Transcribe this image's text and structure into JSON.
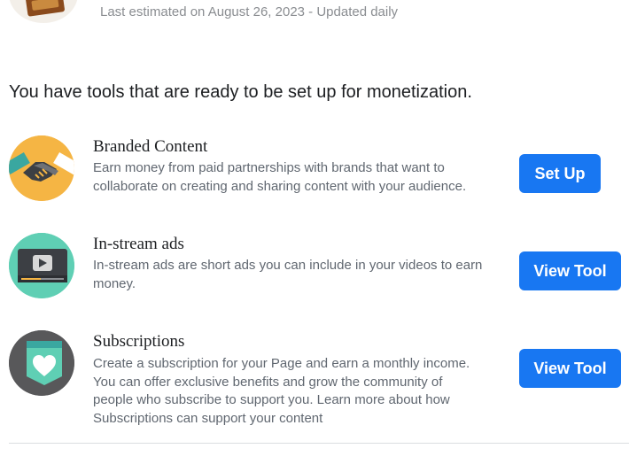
{
  "header": {
    "estimate_text": "Last estimated on August 26, 2023 - Updated daily"
  },
  "headline": "You have tools that are ready to be set up for monetization.",
  "tools": [
    {
      "title": "Branded Content",
      "description": "Earn money from paid partnerships with brands that want to collaborate on creating and sharing content with your audience.",
      "button_label": "Set Up",
      "icon": "handshake-icon",
      "icon_bg": "#f5b544"
    },
    {
      "title": "In-stream ads",
      "description": "In-stream ads are short ads you can include in your videos to earn money.",
      "button_label": "View Tool",
      "icon": "video-player-icon",
      "icon_bg": "#5fcfb4"
    },
    {
      "title": "Subscriptions",
      "description": "Create a subscription for your Page and earn a monthly income. You can offer exclusive benefits and grow the community of people who subscribe to support you. Learn more about how Subscriptions can support your content",
      "button_label": "View Tool",
      "icon": "heart-badge-icon",
      "icon_bg": "#58585a"
    }
  ],
  "colors": {
    "primary_button": "#1877f2",
    "title_text": "#1c1e21",
    "secondary_text": "#606770"
  }
}
